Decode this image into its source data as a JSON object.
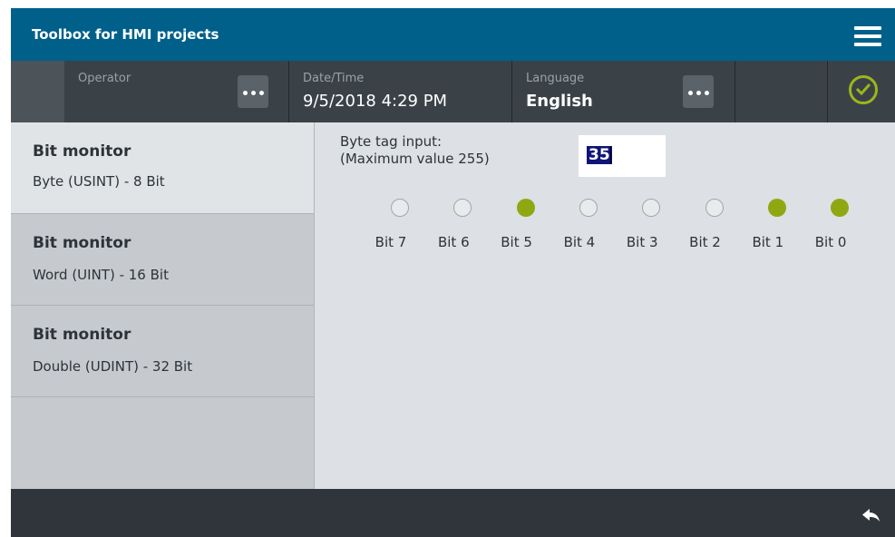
{
  "window": {
    "title": "Toolbox for HMI projects"
  },
  "statusbar": {
    "operator": {
      "label": "Operator",
      "value": ""
    },
    "datetime": {
      "label": "Date/Time",
      "value": "9/5/2018 4:29 PM"
    },
    "language": {
      "label": "Language",
      "value": "English"
    }
  },
  "nav": {
    "items": [
      {
        "title": "Bit monitor",
        "subtitle": "Byte (USINT)  - 8 Bit"
      },
      {
        "title": "Bit monitor",
        "subtitle": "Word (UINT) - 16 Bit"
      },
      {
        "title": "Bit monitor",
        "subtitle": "Double (UDINT) - 32 Bit"
      }
    ]
  },
  "main": {
    "input_label_line1": "Byte tag input:",
    "input_label_line2": "(Maximum value 255)",
    "input_value": "35",
    "bits": [
      {
        "label": "Bit 7",
        "on": false
      },
      {
        "label": "Bit 6",
        "on": false
      },
      {
        "label": "Bit 5",
        "on": true
      },
      {
        "label": "Bit 4",
        "on": false
      },
      {
        "label": "Bit 3",
        "on": false
      },
      {
        "label": "Bit 2",
        "on": false
      },
      {
        "label": "Bit 1",
        "on": true
      },
      {
        "label": "Bit 0",
        "on": true
      }
    ]
  },
  "colors": {
    "titlebar": "#00608a",
    "led_on": "#8fa812",
    "led_off": "#e8eaec",
    "ok_icon": "#9eb51a"
  },
  "icons": {
    "menu": "hamburger-menu-icon",
    "more": "ellipsis-icon",
    "status": "check-circle-icon",
    "back": "back-arrow-icon"
  }
}
